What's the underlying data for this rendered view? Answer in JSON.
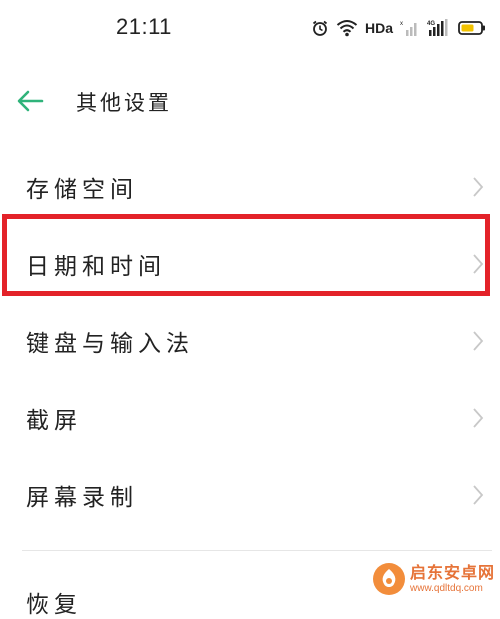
{
  "status_bar": {
    "time": "21:11",
    "network_label": "HDa",
    "signal_label": "4G"
  },
  "header": {
    "title": "其他设置",
    "back_icon": "arrow-left-icon"
  },
  "colors": {
    "accent": "#2fb37a",
    "highlight": "#e32229",
    "chevron": "#c8c8c8"
  },
  "settings_list": {
    "items": [
      {
        "label": "存储空间",
        "icon": "chevron-right-icon"
      },
      {
        "label": "日期和时间",
        "icon": "chevron-right-icon",
        "highlighted": true
      },
      {
        "label": "键盘与输入法",
        "icon": "chevron-right-icon"
      },
      {
        "label": "截屏",
        "icon": "chevron-right-icon"
      },
      {
        "label": "屏幕录制",
        "icon": "chevron-right-icon"
      }
    ],
    "partial_item_label": "恢复"
  },
  "watermark": {
    "title": "启东安卓网",
    "url": "www.qdltdq.com"
  }
}
